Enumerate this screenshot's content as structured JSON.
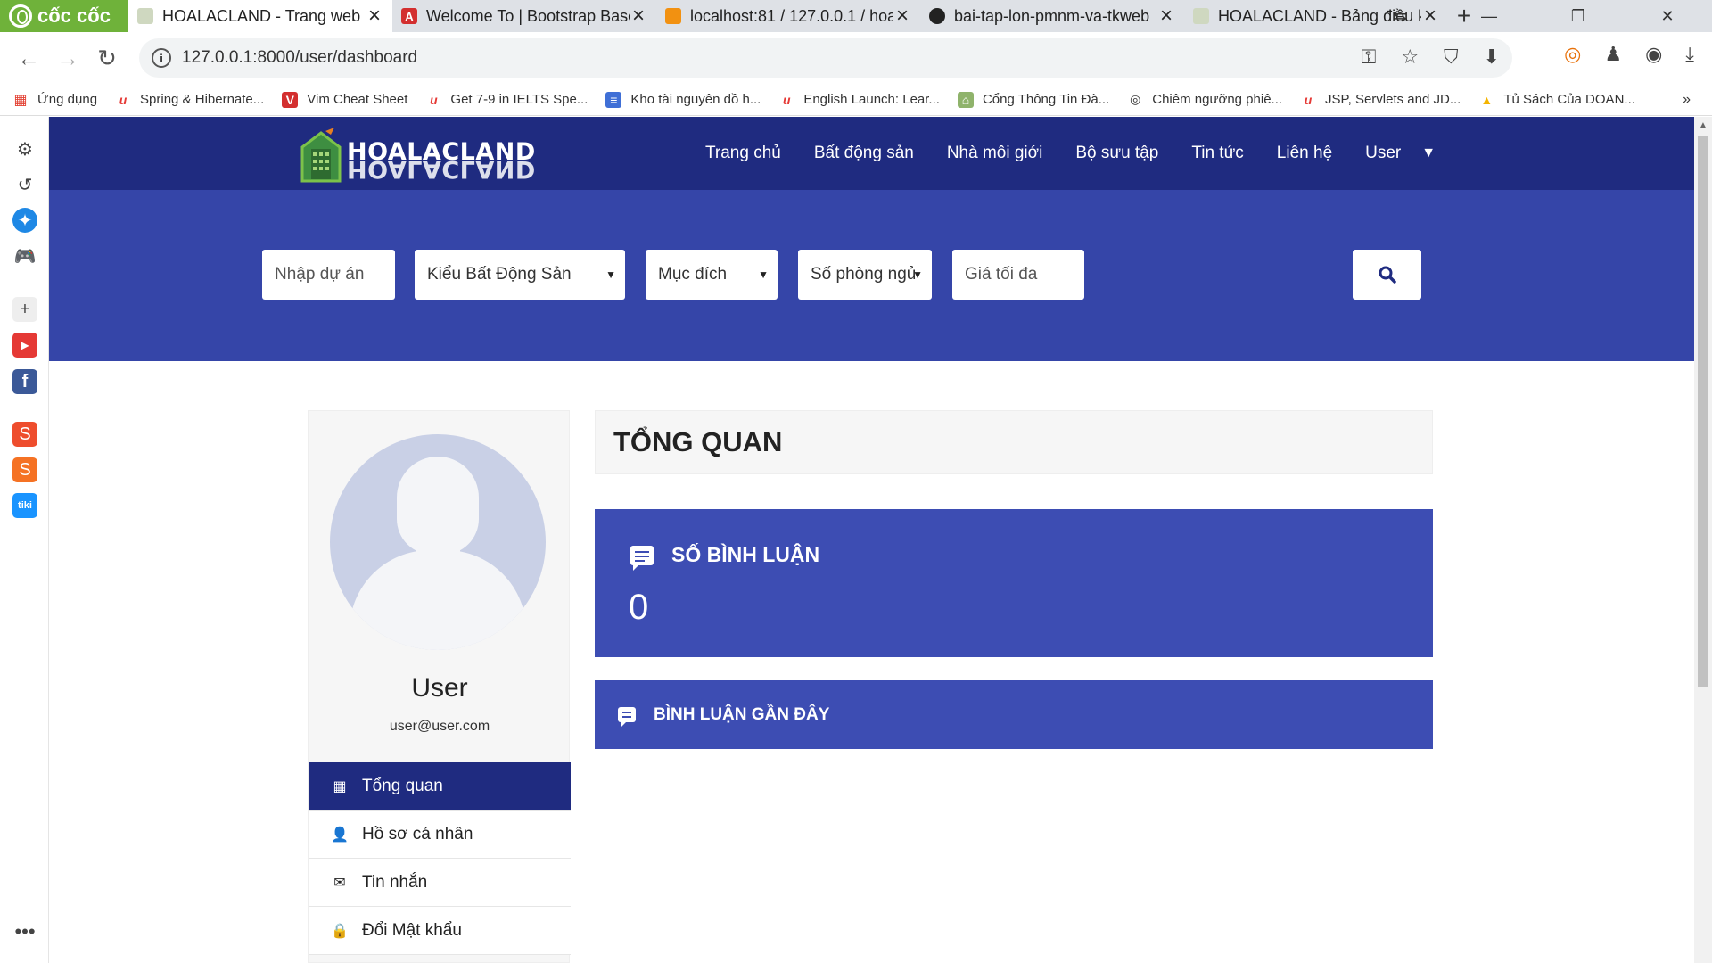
{
  "browser": {
    "brand": "cốc cốc",
    "tabs": [
      {
        "title": "HOALACLAND - Trang web m",
        "active": true
      },
      {
        "title": "Welcome To | Bootstrap Base",
        "active": false
      },
      {
        "title": "localhost:81 / 127.0.0.1 / hoa",
        "active": false
      },
      {
        "title": "bai-tap-lon-pmnm-va-tkweb",
        "active": false
      },
      {
        "title": "HOALACLAND - Bảng điều k",
        "active": false
      }
    ],
    "url": "127.0.0.1:8000/user/dashboard",
    "bookmarks": [
      {
        "label": "Ứng dụng",
        "color": "#4285f4"
      },
      {
        "label": "Spring & Hibernate...",
        "color": "#e53935"
      },
      {
        "label": "Vim Cheat Sheet",
        "color": "#d32f2f"
      },
      {
        "label": "Get 7-9 in IELTS Spe...",
        "color": "#e53935"
      },
      {
        "label": "Kho tài nguyên đồ h...",
        "color": "#3f6fd6"
      },
      {
        "label": "English Launch: Lear...",
        "color": "#e53935"
      },
      {
        "label": "Cổng Thông Tin Đà...",
        "color": "#5a8f3c"
      },
      {
        "label": "Chiêm ngưỡng phiê...",
        "color": "#333333"
      },
      {
        "label": "JSP, Servlets and JD...",
        "color": "#e53935"
      },
      {
        "label": "Tủ Sách Của DOAN...",
        "color": "#f4b400"
      }
    ]
  },
  "site": {
    "logo_text": "HOALACLAND",
    "menu": [
      "Trang chủ",
      "Bất động sản",
      "Nhà môi giới",
      "Bộ sưu tập",
      "Tin tức",
      "Liên hệ",
      "User"
    ],
    "search": {
      "project_placeholder": "Nhập dự án",
      "type_select": "Kiểu Bất Động Sản",
      "purpose_select": "Mục đích",
      "bedrooms_select": "Số phòng ngủ",
      "max_price_placeholder": "Giá tối đa"
    },
    "colors": {
      "nav": "#1f2b80",
      "hero": "#3545a8",
      "card": "#3d4db3"
    }
  },
  "profile": {
    "name": "User",
    "email": "user@user.com",
    "menu": [
      "Tổng quan",
      "Hồ sơ cá nhân",
      "Tin nhắn",
      "Đổi Mật khẩu"
    ]
  },
  "dashboard": {
    "title": "TỔNG QUAN",
    "comment_count_label": "SỐ BÌNH LUẬN",
    "comment_count": "0",
    "recent_comments_label": "BÌNH LUẬN GẦN ĐÂY"
  }
}
